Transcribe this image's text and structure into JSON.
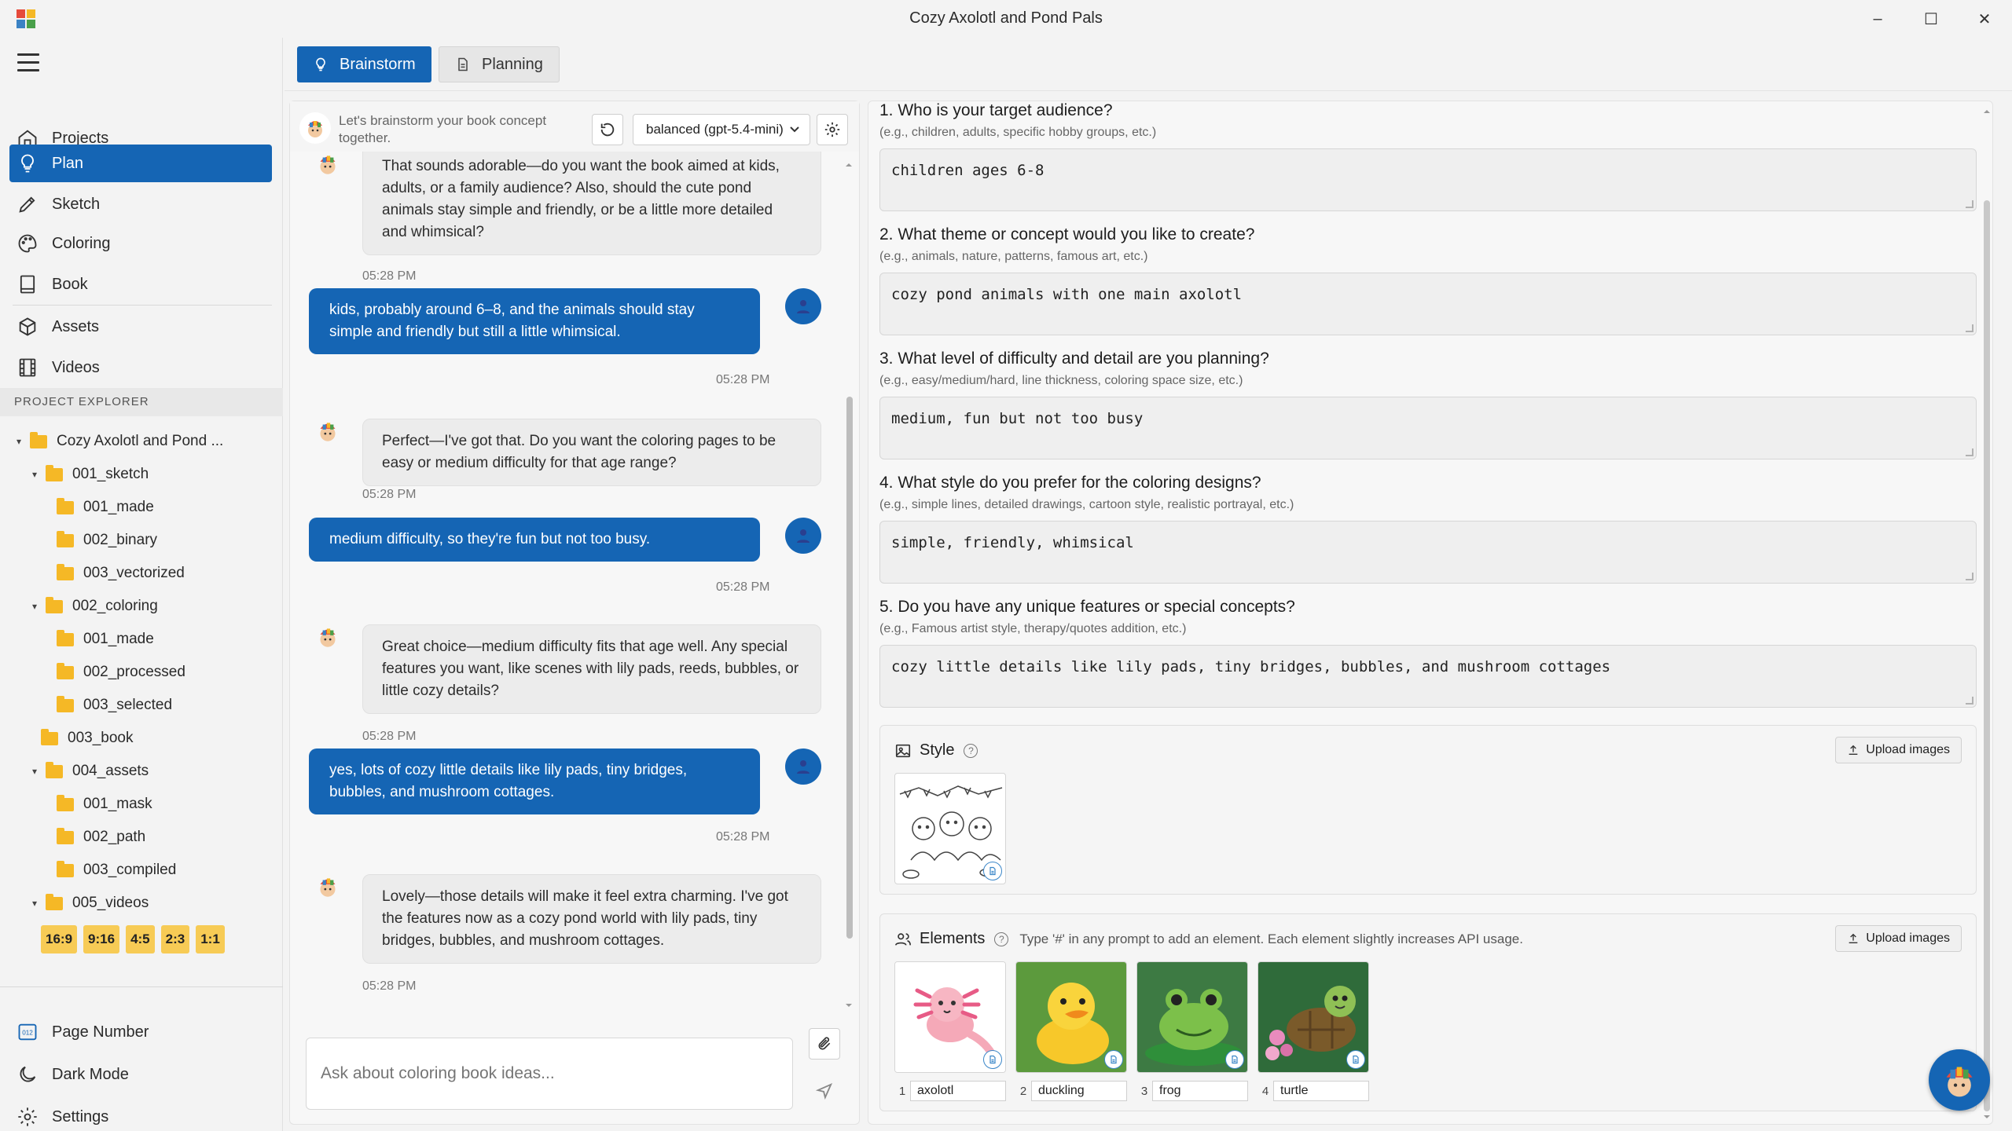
{
  "window": {
    "title": "Cozy Axolotl and Pond Pals",
    "minimize": "–",
    "maximize": "☐",
    "close": "✕"
  },
  "sidebar": {
    "nav": [
      {
        "label": "Projects",
        "icon": "home-icon"
      },
      {
        "label": "Plan",
        "icon": "lightbulb-icon",
        "active": true
      },
      {
        "label": "Sketch",
        "icon": "pen-icon"
      },
      {
        "label": "Coloring",
        "icon": "palette-icon"
      },
      {
        "label": "Book",
        "icon": "book-icon"
      },
      {
        "label": "Assets",
        "icon": "cube-icon"
      },
      {
        "label": "Videos",
        "icon": "film-icon"
      }
    ],
    "explorer_title": "PROJECT EXPLORER",
    "tree": [
      {
        "label": "Cozy Axolotl and Pond ...",
        "caret": "▾"
      },
      {
        "label": "001_sketch",
        "caret": "▾"
      },
      {
        "label": "001_made",
        "caret": ""
      },
      {
        "label": "002_binary",
        "caret": ""
      },
      {
        "label": "003_vectorized",
        "caret": ""
      },
      {
        "label": "002_coloring",
        "caret": "▾"
      },
      {
        "label": "001_made",
        "caret": ""
      },
      {
        "label": "002_processed",
        "caret": ""
      },
      {
        "label": "003_selected",
        "caret": ""
      },
      {
        "label": "003_book",
        "caret": ""
      },
      {
        "label": "004_assets",
        "caret": "▾"
      },
      {
        "label": "001_mask",
        "caret": ""
      },
      {
        "label": "002_path",
        "caret": ""
      },
      {
        "label": "003_compiled",
        "caret": ""
      },
      {
        "label": "005_videos",
        "caret": "▾"
      }
    ],
    "ratios": [
      "16:9",
      "9:16",
      "4:5",
      "2:3",
      "1:1"
    ],
    "bottom": [
      {
        "label": "Page Number",
        "icon": "page-number-icon"
      },
      {
        "label": "Dark Mode",
        "icon": "moon-icon"
      },
      {
        "label": "Settings",
        "icon": "gear-icon"
      }
    ]
  },
  "tabs": [
    {
      "label": "Brainstorm",
      "active": true
    },
    {
      "label": "Planning",
      "active": false
    }
  ],
  "chat": {
    "intro": "Let's brainstorm your book concept together.",
    "model": "balanced (gpt-5.4-mini)",
    "messages": [
      {
        "role": "bot",
        "text": "That sounds adorable—do you want the book aimed at kids, adults, or a family audience? Also, should the cute pond animals stay simple and friendly, or be a little more detailed and whimsical?",
        "time": "05:28 PM"
      },
      {
        "role": "user",
        "text": "kids, probably around 6–8, and the animals should stay simple and friendly but still a little whimsical.",
        "time": "05:28 PM"
      },
      {
        "role": "bot",
        "text": "Perfect—I've got that. Do you want the coloring pages to be easy or medium difficulty for that age range?",
        "time": "05:28 PM"
      },
      {
        "role": "user",
        "text": "medium difficulty, so they're fun but not too busy.",
        "time": "05:28 PM"
      },
      {
        "role": "bot",
        "text": "Great choice—medium difficulty fits that age well. Any special features you want, like scenes with lily pads, reeds, bubbles, or little cozy details?",
        "time": "05:28 PM"
      },
      {
        "role": "user",
        "text": "yes, lots of cozy little details like lily pads, tiny bridges, bubbles, and mushroom cottages.",
        "time": "05:28 PM"
      },
      {
        "role": "bot",
        "text": "Lovely—those details will make it feel extra charming. I've got the features now as a cozy pond world with lily pads, tiny bridges, bubbles, and mushroom cottages.",
        "time": "05:28 PM"
      }
    ],
    "input_placeholder": "Ask about coloring book ideas..."
  },
  "form": {
    "questions": [
      {
        "title": "1. Who is your target audience?",
        "hint": "(e.g., children, adults, specific hobby groups, etc.)",
        "value": "children ages 6-8"
      },
      {
        "title": "2. What theme or concept would you like to create?",
        "hint": "(e.g., animals, nature, patterns, famous art, etc.)",
        "value": "cozy pond animals with one main axolotl"
      },
      {
        "title": "3. What level of difficulty and detail are you planning?",
        "hint": "(e.g., easy/medium/hard, line thickness, coloring space size, etc.)",
        "value": "medium, fun but not too busy"
      },
      {
        "title": "4. What style do you prefer for the coloring designs?",
        "hint": "(e.g., simple lines, detailed drawings, cartoon style, realistic portrayal, etc.)",
        "value": "simple, friendly, whimsical"
      },
      {
        "title": "5. Do you have any unique features or special concepts?",
        "hint": "(e.g., Famous artist style, therapy/quotes addition, etc.)",
        "value": "cozy little details like lily pads, tiny bridges, bubbles, and mushroom cottages"
      }
    ],
    "style": {
      "title": "Style",
      "help": "?",
      "upload": "Upload images"
    },
    "elements": {
      "title": "Elements",
      "help": "?",
      "hint": "Type '#' in any prompt to add an element. Each element slightly increases API usage.",
      "upload": "Upload images",
      "items": [
        {
          "index": "1",
          "name": "axolotl"
        },
        {
          "index": "2",
          "name": "duckling"
        },
        {
          "index": "3",
          "name": "frog"
        },
        {
          "index": "4",
          "name": "turtle"
        }
      ]
    }
  },
  "colors": {
    "accent": "#1565b4",
    "folder": "#f5b826",
    "ratio_chip": "#f7cb55"
  }
}
